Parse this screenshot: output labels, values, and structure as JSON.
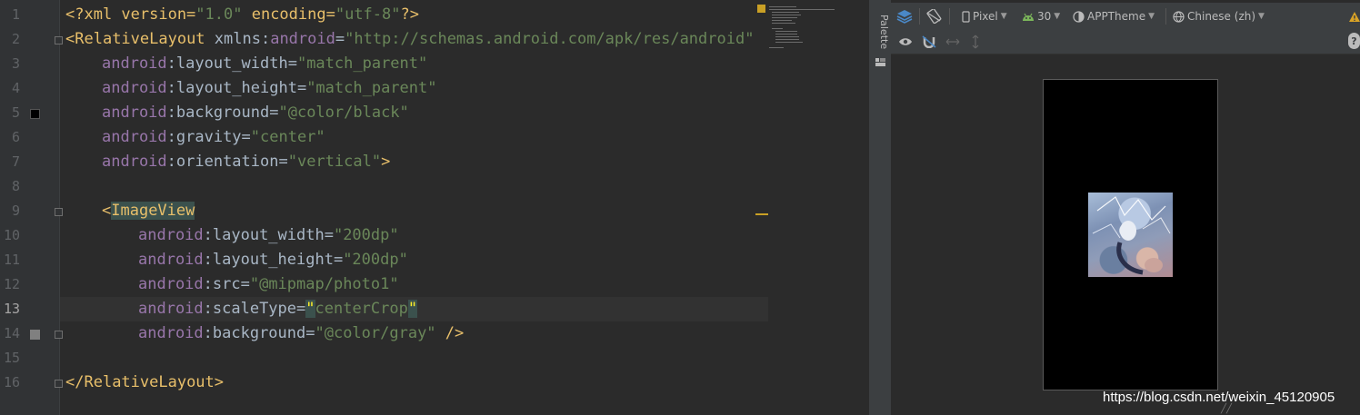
{
  "editor": {
    "line_numbers": [
      "1",
      "2",
      "3",
      "4",
      "5",
      "6",
      "7",
      "8",
      "9",
      "10",
      "11",
      "12",
      "13",
      "14",
      "15",
      "16"
    ],
    "current_line": "13",
    "lines": {
      "l1": {
        "a": "<?xml version=",
        "b": "\"1.0\"",
        "c": " encoding=",
        "d": "\"utf-8\"",
        "e": "?>"
      },
      "l2": {
        "a": "<",
        "b": "RelativeLayout",
        "c": " xmlns:",
        "d": "android",
        "e": "=",
        "f": "\"http://schemas.android.com/apk/res/android\""
      },
      "l3": {
        "ns": "android",
        "attr": ":layout_width=",
        "val": "\"match_parent\""
      },
      "l4": {
        "ns": "android",
        "attr": ":layout_height=",
        "val": "\"match_parent\""
      },
      "l5": {
        "ns": "android",
        "attr": ":background=",
        "val": "\"@color/black\""
      },
      "l6": {
        "ns": "android",
        "attr": ":gravity=",
        "val": "\"center\""
      },
      "l7": {
        "ns": "android",
        "attr": ":orientation=",
        "val": "\"vertical\"",
        "end": ">"
      },
      "l9": {
        "open": "<",
        "tag": "ImageView"
      },
      "l10": {
        "ns": "android",
        "attr": ":layout_width=",
        "val": "\"200dp\""
      },
      "l11": {
        "ns": "android",
        "attr": ":layout_height=",
        "val": "\"200dp\""
      },
      "l12": {
        "ns": "android",
        "attr": ":src=",
        "val": "\"@mipmap/photo1\""
      },
      "l13": {
        "ns": "android",
        "attr": ":scaleType=",
        "q1": "\"",
        "val": "centerCrop",
        "q2": "\""
      },
      "l14": {
        "ns": "android",
        "attr": ":background=",
        "val": "\"@color/gray\"",
        "end": " />"
      },
      "l16": {
        "open": "</",
        "tag": "RelativeLayout",
        "end": ">"
      }
    },
    "swatches": {
      "black": "#000000",
      "gray": "#808080"
    }
  },
  "palette": {
    "label": "Palette"
  },
  "toolbar": {
    "device": "Pixel",
    "api": "30",
    "theme": "APPTheme",
    "locale": "Chinese (zh)",
    "help": "?"
  },
  "watermark": "https://blog.csdn.net/weixin_45120905"
}
